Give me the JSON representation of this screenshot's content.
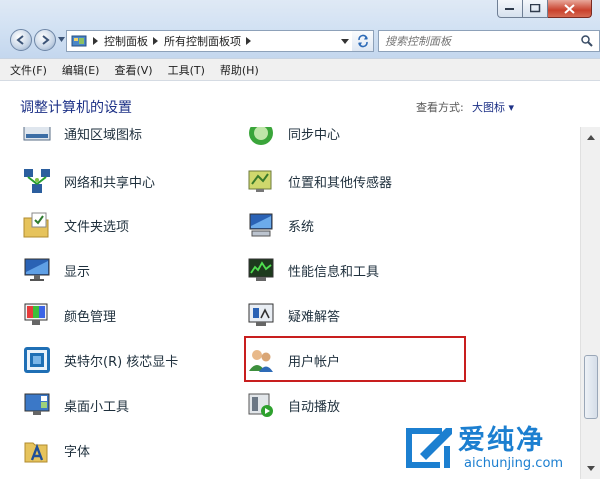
{
  "address": {
    "segments": [
      "控制面板",
      "所有控制面板项"
    ]
  },
  "search": {
    "placeholder": "搜索控制面板"
  },
  "menu": [
    "文件(F)",
    "编辑(E)",
    "查看(V)",
    "工具(T)",
    "帮助(H)"
  ],
  "header": {
    "title": "调整计算机的设置",
    "view_label": "查看方式:",
    "view_value": "大图标 ▾"
  },
  "items_left": [
    {
      "label": "通知区域图标",
      "icon": "notification-area-icon"
    },
    {
      "label": "网络和共享中心",
      "icon": "network-sharing-icon"
    },
    {
      "label": "文件夹选项",
      "icon": "folder-options-icon"
    },
    {
      "label": "显示",
      "icon": "display-icon"
    },
    {
      "label": "颜色管理",
      "icon": "color-management-icon"
    },
    {
      "label": "英特尔(R) 核芯显卡",
      "icon": "intel-graphics-icon"
    },
    {
      "label": "桌面小工具",
      "icon": "desktop-gadgets-icon"
    },
    {
      "label": "字体",
      "icon": "fonts-icon"
    }
  ],
  "items_right": [
    {
      "label": "同步中心",
      "icon": "sync-center-icon"
    },
    {
      "label": "位置和其他传感器",
      "icon": "location-sensors-icon"
    },
    {
      "label": "系统",
      "icon": "system-icon"
    },
    {
      "label": "性能信息和工具",
      "icon": "performance-icon"
    },
    {
      "label": "疑难解答",
      "icon": "troubleshooting-icon"
    },
    {
      "label": "用户帐户",
      "icon": "user-accounts-icon"
    },
    {
      "label": "自动播放",
      "icon": "autoplay-icon"
    }
  ],
  "watermark": {
    "text": "爱纯净",
    "url": "aichunjing.com"
  }
}
